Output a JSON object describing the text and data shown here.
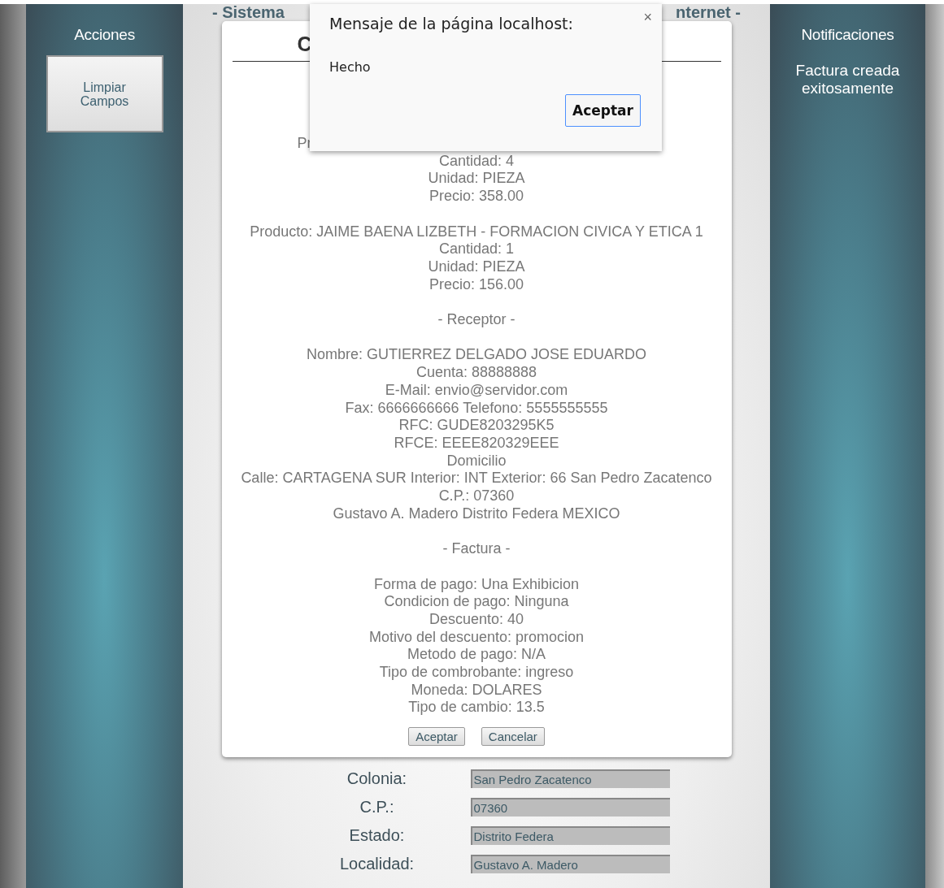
{
  "header": {
    "left": "- Sistema",
    "right": "nternet -"
  },
  "actions": {
    "title": "Acciones",
    "buttons": [
      "Limpiar Campos"
    ]
  },
  "notifications": {
    "title": "Notificaciones",
    "messages": [
      "Factura creada exitosamente"
    ]
  },
  "summary": {
    "title": "C",
    "partial_line": "Pr",
    "blocks": [
      [
        "Cantidad: 4",
        "Unidad: PIEZA",
        "Precio: 358.00"
      ],
      [
        "Producto: JAIME BAENA LIZBETH - FORMACION CIVICA Y ETICA 1",
        "Cantidad: 1",
        "Unidad: PIEZA",
        "Precio: 156.00"
      ],
      [
        "- Receptor -"
      ],
      [
        "Nombre: GUTIERREZ DELGADO JOSE EDUARDO",
        "Cuenta: 88888888",
        "E-Mail: envio@servidor.com",
        "Fax: 6666666666 Telefono: 5555555555",
        "RFC: GUDE8203295K5",
        "RFCE: EEEE820329EEE",
        "Domicilio",
        "Calle: CARTAGENA SUR Interior: INT Exterior: 66 San Pedro Zacatenco C.P.: 07360",
        "Gustavo A. Madero Distrito Federa MEXICO"
      ],
      [
        "- Factura -"
      ],
      [
        "Forma de pago: Una Exhibicion",
        "Condicion de pago: Ninguna",
        "Descuento: 40",
        "Motivo del descuento: promocion",
        "Metodo de pago: N/A",
        "Tipo de combrobante: ingreso",
        "Moneda: DOLARES",
        "Tipo de cambio: 13.5"
      ]
    ],
    "buttons": [
      "Aceptar",
      "Cancelar"
    ]
  },
  "form": {
    "fields": [
      {
        "label": "Colonia:",
        "value": "San Pedro Zacatenco"
      },
      {
        "label": "C.P.:",
        "value": "07360"
      },
      {
        "label": "Estado:",
        "value": "Distrito Federa"
      },
      {
        "label": "Localidad:",
        "value": "Gustavo A. Madero"
      }
    ]
  },
  "dialog": {
    "title": "Mensaje de la página localhost:",
    "close": "×",
    "message": "Hecho",
    "button": "Aceptar"
  }
}
